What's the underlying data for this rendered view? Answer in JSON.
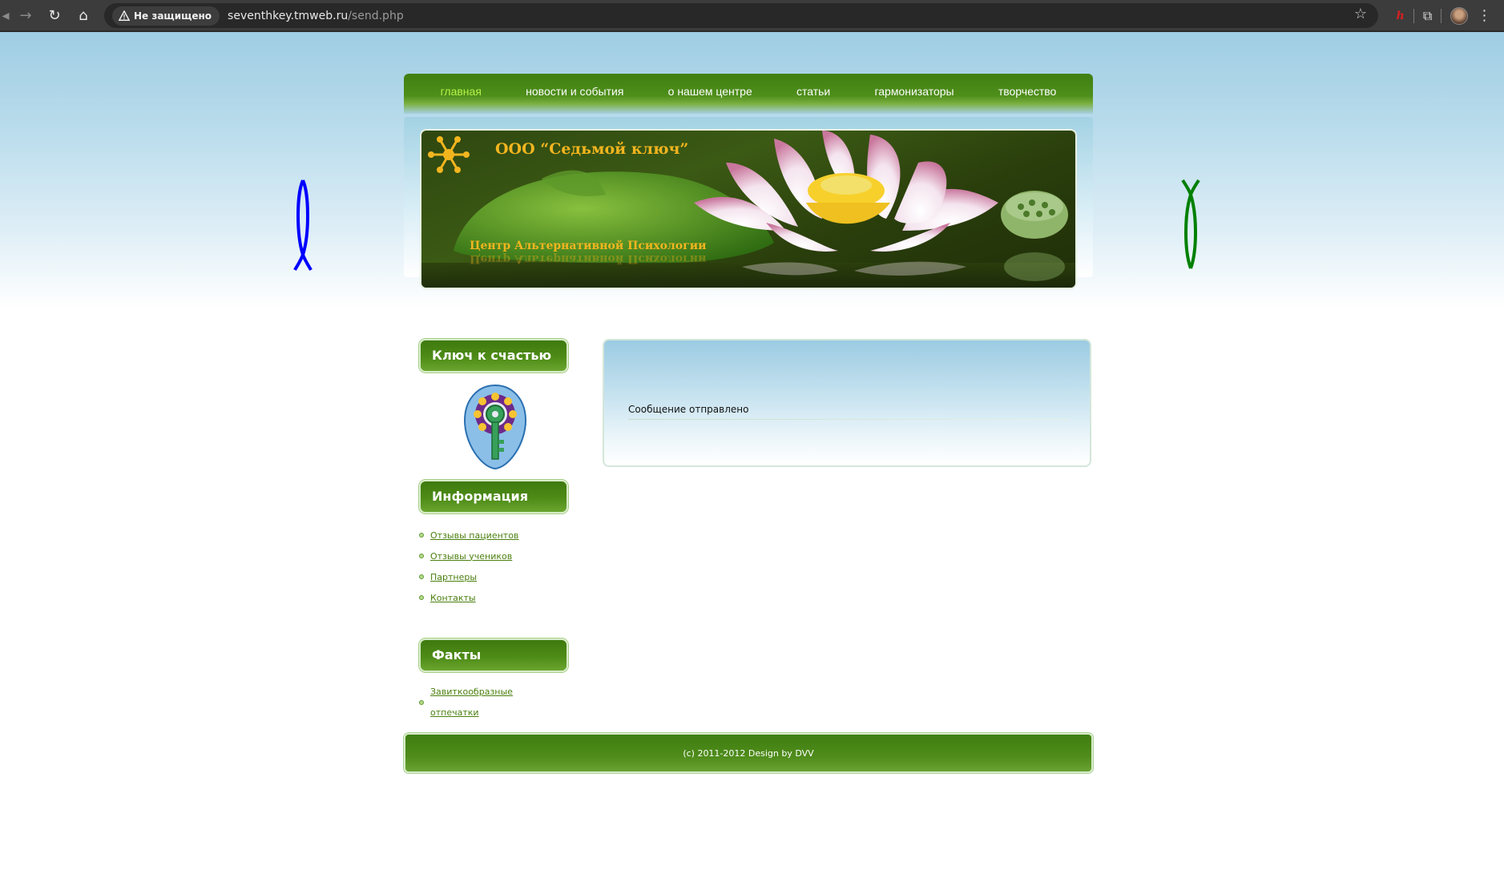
{
  "browser": {
    "security_label": "Не защищено",
    "url_host": "seventhkey.tmweb.ru",
    "url_path": "/send.php",
    "extension_label": "h"
  },
  "nav": {
    "items": [
      "главная",
      "новости и события",
      "о нашем центре",
      "статьи",
      "гармонизаторы",
      "творчество"
    ],
    "active_color": "#b6f24a"
  },
  "banner": {
    "title": "ООО “Седьмой ключ”",
    "subtitle": "Центр Альтернативной Психологии"
  },
  "sidebar": {
    "key_heading": "Ключ к счастью",
    "info_heading": "Информация",
    "info_links": [
      "Отзывы пациентов",
      "Отзывы учеников",
      "Партнеры",
      "Контакты"
    ],
    "facts_heading": "Факты",
    "facts_links": [
      "Завиткообразные отпечатки"
    ]
  },
  "content": {
    "message": "Сообщение отправлено"
  },
  "footer": {
    "text": "(c) 2011-2012 Design by DVV"
  },
  "colors": {
    "green_dark": "#3e7a0e",
    "link_green": "#4a7f0e",
    "sky_blue": "#9fcde3",
    "ribbon_left": "#0000ff",
    "ribbon_right": "#008000"
  }
}
